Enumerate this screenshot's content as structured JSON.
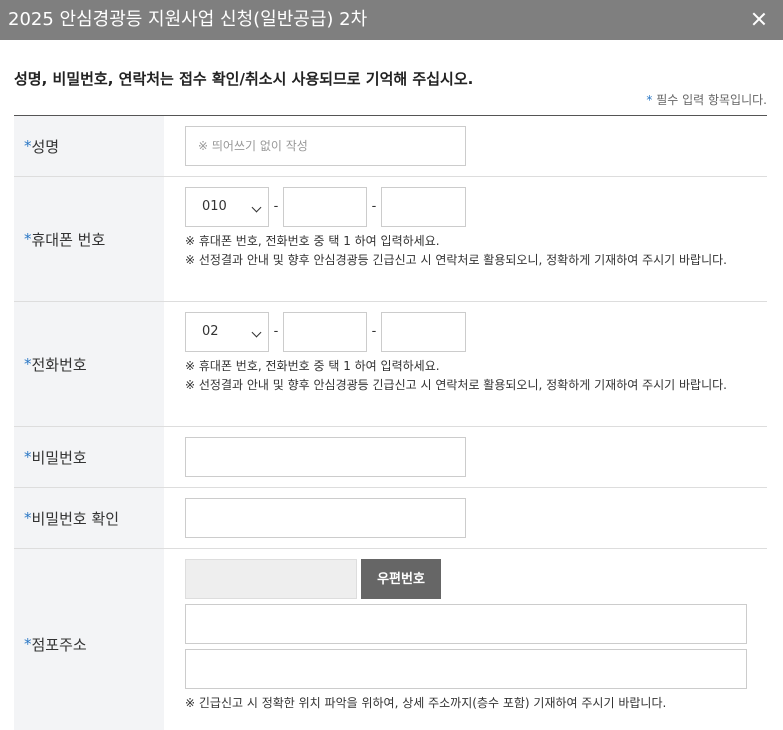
{
  "dialog": {
    "title": "2025 안심경광등 지원사업 신청(일반공급) 2차"
  },
  "notice": "성명, 비밀번호, 연락처는 접수 확인/취소시 사용되므로 기억해 주십시오.",
  "required_note": {
    "star": "*",
    "text": " 필수 입력 항목입니다."
  },
  "form": {
    "star": "*",
    "name": {
      "label": "성명",
      "placeholder": "※ 띄어쓰기 없이 작성"
    },
    "mobile": {
      "label": "휴대폰 번호",
      "prefix": "010",
      "dash": "-",
      "help1": "※ 휴대폰 번호, 전화번호 중 택 1 하여 입력하세요.",
      "help2": "※ 선정결과 안내 및 향후 안심경광등 긴급신고 시 연락처로 활용되오니, 정확하게 기재하여 주시기 바랍니다."
    },
    "phone": {
      "label": "전화번호",
      "prefix": "02",
      "dash": "-",
      "help1": "※ 휴대폰 번호, 전화번호 중 택 1 하여 입력하세요.",
      "help2": "※ 선정결과 안내 및 향후 안심경광등 긴급신고 시 연락처로 활용되오니, 정확하게 기재하여 주시기 바랍니다."
    },
    "password": {
      "label": "비밀번호"
    },
    "password_confirm": {
      "label": "비밀번호 확인"
    },
    "address": {
      "label": "점포주소",
      "zip_button": "우편번호",
      "help": "※ 긴급신고 시 정확한 위치 파악을 위하여, 상세 주소까지(층수 포함) 기재하여 주시기 바랍니다."
    }
  }
}
